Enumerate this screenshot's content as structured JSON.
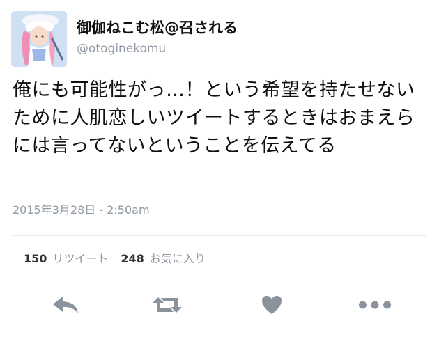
{
  "tweet": {
    "display_name": "御伽ねこむ松@召される",
    "handle": "@otoginekomu",
    "text": "俺にも可能性がっ…！という希望を持たせないために人肌恋しいツイートするときはおまえらには言ってないということを伝えてる",
    "timestamp": "2015年3月28日 - 2:50am"
  },
  "stats": {
    "retweets_count": "150",
    "retweets_label": "リツイート",
    "favorites_count": "248",
    "favorites_label": "お気に入り"
  },
  "actions": {
    "reply_icon": "reply-icon",
    "retweet_icon": "retweet-icon",
    "favorite_icon": "heart-icon",
    "more_icon": "more-icon"
  },
  "colors": {
    "text": "#111111",
    "muted": "#8f98a3",
    "icon": "#8b939c",
    "divider": "#e3e6ea"
  }
}
